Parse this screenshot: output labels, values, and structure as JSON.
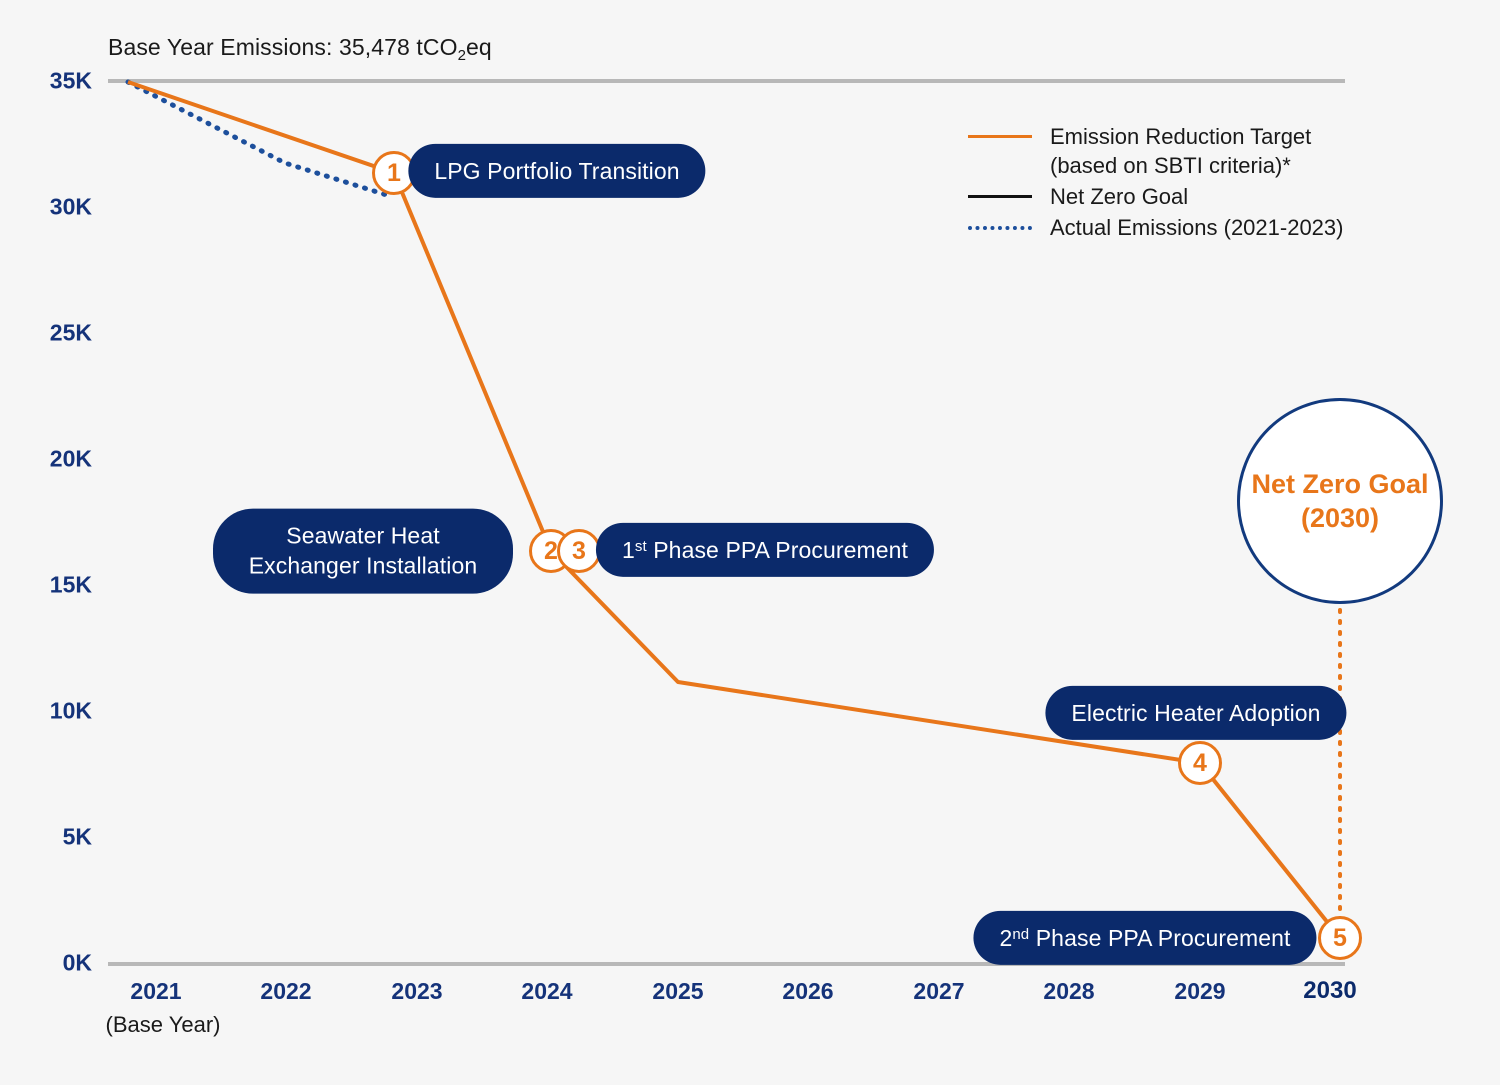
{
  "chart": {
    "title_prefix": "Base Year Emissions: 35,478 tCO",
    "title_sub": "2",
    "title_suffix": "eq",
    "title_full": "Base Year Emissions: 35,478 tCO2eq"
  },
  "axes": {
    "y_ticks": [
      "35K",
      "30K",
      "25K",
      "20K",
      "15K",
      "10K",
      "5K",
      "0K"
    ],
    "x_ticks": [
      "2021",
      "2022",
      "2023",
      "2024",
      "2025",
      "2026",
      "2027",
      "2028",
      "2029",
      "2030"
    ],
    "x_base_year_note": "(Base Year)"
  },
  "legend": {
    "items": [
      {
        "label_line1": "Emission Reduction Target",
        "label_line2": "(based on SBTI criteria)*",
        "style": "solid",
        "color": "#e8761a"
      },
      {
        "label_line1": "Net Zero Goal",
        "label_line2": "",
        "style": "solid",
        "color": "#111111"
      },
      {
        "label_line1": "Actual Emissions (2021-2023)",
        "label_line2": "",
        "style": "dotted",
        "color": "#1d4f9c"
      }
    ]
  },
  "milestones": [
    {
      "number": "1",
      "label": "LPG Portfolio Transition",
      "year": "2023"
    },
    {
      "number": "2",
      "label": "Seawater Heat Exchanger Installation",
      "label_line1": "Seawater Heat",
      "label_line2": "Exchanger Installation",
      "year": "2024"
    },
    {
      "number": "3",
      "label": "1st Phase PPA Procurement",
      "label_main": "Phase PPA Procurement",
      "label_ord_num": "1",
      "label_ord_sup": "st",
      "year": "2024"
    },
    {
      "number": "4",
      "label": "Electric Heater Adoption",
      "year": "2029"
    },
    {
      "number": "5",
      "label": "2nd Phase PPA Procurement",
      "label_main": "Phase PPA Procurement",
      "label_ord_num": "2",
      "label_ord_sup": "nd",
      "year": "2030"
    }
  ],
  "goal": {
    "line1": "Net Zero Goal",
    "line2": "(2030)"
  },
  "colors": {
    "target_orange": "#e8761a",
    "navy": "#0b2a6b",
    "tick_navy": "#15337a",
    "actual_blue": "#1d4f9c",
    "background": "#f6f6f6",
    "gridline": "#b8b8b8"
  },
  "chart_data": {
    "type": "line",
    "title": "Base Year Emissions: 35,478 tCO2eq",
    "xlabel": "",
    "ylabel": "tCO2eq",
    "ylim": [
      0,
      35000
    ],
    "yticks": [
      0,
      5000,
      10000,
      15000,
      20000,
      25000,
      30000,
      35000
    ],
    "ytick_labels": [
      "0K",
      "5K",
      "10K",
      "15K",
      "20K",
      "25K",
      "30K",
      "35K"
    ],
    "x": [
      "2021",
      "2022",
      "2023",
      "2024",
      "2025",
      "2026",
      "2027",
      "2028",
      "2029",
      "2030"
    ],
    "grid": false,
    "legend_position": "upper right",
    "series": [
      {
        "name": "Emission Reduction Target (based on SBTI criteria)*",
        "style": "solid",
        "color": "#e8761a",
        "x": [
          "2021",
          "2023",
          "2024",
          "2025",
          "2029",
          "2030"
        ],
        "values": [
          35478,
          31350,
          16450,
          11200,
          8000,
          1050
        ]
      },
      {
        "name": "Net Zero Goal",
        "style": "solid",
        "color": "#111111",
        "x": [
          "2030"
        ],
        "values": [
          0
        ]
      },
      {
        "name": "Actual Emissions (2021-2023)",
        "style": "dotted",
        "color": "#1d4f9c",
        "x": [
          "2021",
          "2022",
          "2023"
        ],
        "values": [
          35478,
          31800,
          30400
        ]
      }
    ],
    "annotations": [
      {
        "number": "1",
        "text": "LPG Portfolio Transition",
        "x": "2023",
        "y": 31350
      },
      {
        "number": "2",
        "text": "Seawater Heat Exchanger Installation",
        "x": "2024",
        "y": 16450
      },
      {
        "number": "3",
        "text": "1st Phase PPA Procurement",
        "x": "2024",
        "y": 16400
      },
      {
        "number": "4",
        "text": "Electric Heater Adoption",
        "x": "2029",
        "y": 8000
      },
      {
        "number": "5",
        "text": "2nd Phase PPA Procurement",
        "x": "2030",
        "y": 1050
      },
      {
        "number": "",
        "text": "Net Zero Goal (2030)",
        "x": "2030",
        "y": 20000
      }
    ]
  }
}
